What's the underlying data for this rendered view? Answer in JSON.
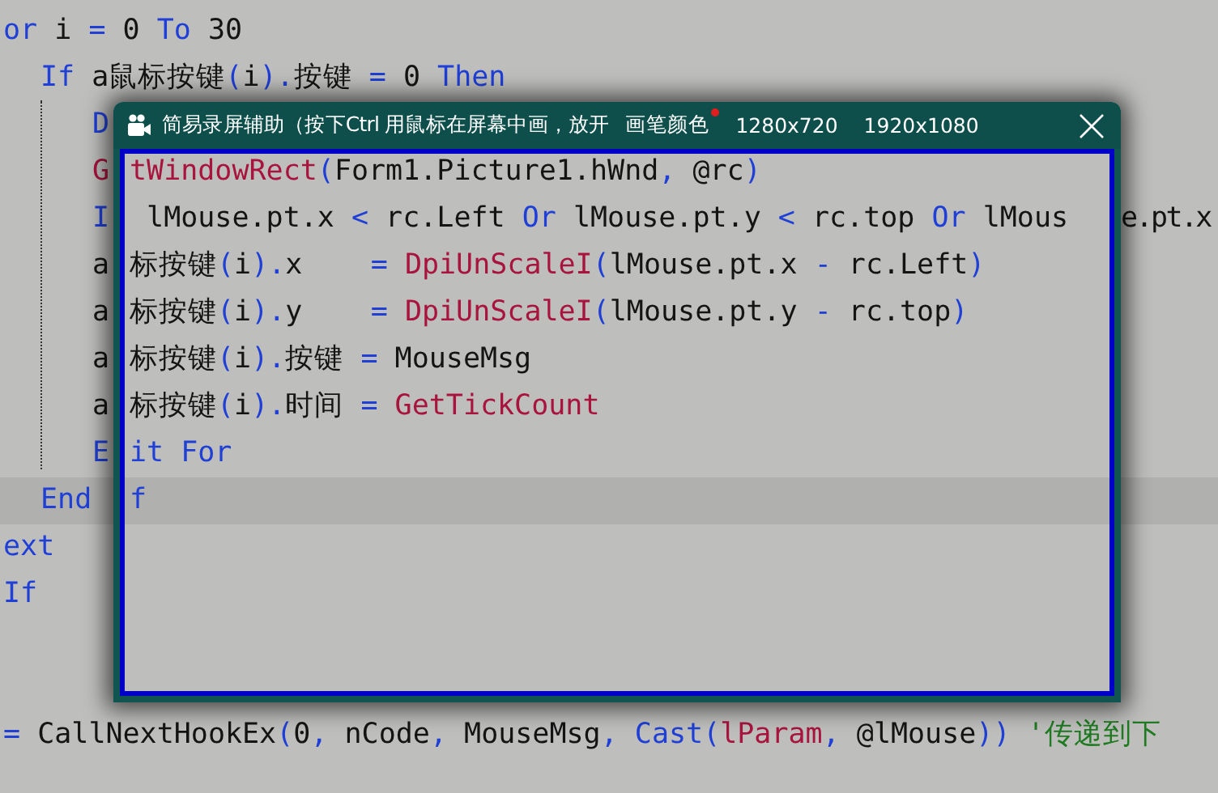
{
  "editor": {
    "lines": [
      {
        "current": false,
        "tokens": [
          {
            "kind": "kw",
            "text": "or"
          },
          {
            "kind": "id",
            "text": " i "
          },
          {
            "kind": "op",
            "text": "="
          },
          {
            "kind": "id",
            "text": " 0 "
          },
          {
            "kind": "kw",
            "text": "To"
          },
          {
            "kind": "id",
            "text": " 30"
          }
        ],
        "children": [
          {
            "current": false,
            "tokens": [
              {
                "kind": "kw",
                "text": "If"
              },
              {
                "kind": "id",
                "text": " a鼠标按键"
              },
              {
                "kind": "op",
                "text": "("
              },
              {
                "kind": "id",
                "text": "i"
              },
              {
                "kind": "op",
                "text": ")."
              },
              {
                "kind": "id",
                "text": "按键 "
              },
              {
                "kind": "op",
                "text": "="
              },
              {
                "kind": "id",
                "text": " 0 "
              },
              {
                "kind": "kw",
                "text": "Then"
              }
            ],
            "children": [
              {
                "current": false,
                "tokens": [
                  {
                    "kind": "kw",
                    "text": "D"
                  }
                ]
              },
              {
                "current": false,
                "tokens": [
                  {
                    "kind": "fn",
                    "text": "G"
                  }
                ],
                "inside": [
                  {
                    "kind": "fn",
                    "text": "tWindowRect"
                  },
                  {
                    "kind": "op",
                    "text": "("
                  },
                  {
                    "kind": "id",
                    "text": "Form1.Picture1.hWnd"
                  },
                  {
                    "kind": "op",
                    "text": ","
                  },
                  {
                    "kind": "id",
                    "text": " @rc"
                  },
                  {
                    "kind": "op",
                    "text": ")"
                  }
                ]
              },
              {
                "current": false,
                "tokens": [
                  {
                    "kind": "kw",
                    "text": "I"
                  }
                ],
                "inside": [
                  {
                    "kind": "id",
                    "text": " lMouse.pt.x "
                  },
                  {
                    "kind": "op",
                    "text": "<"
                  },
                  {
                    "kind": "id",
                    "text": " rc.Left "
                  },
                  {
                    "kind": "kw",
                    "text": "Or"
                  },
                  {
                    "kind": "id",
                    "text": " lMouse.pt.y "
                  },
                  {
                    "kind": "op",
                    "text": "<"
                  },
                  {
                    "kind": "id",
                    "text": " rc.top "
                  },
                  {
                    "kind": "kw",
                    "text": "Or"
                  },
                  {
                    "kind": "id",
                    "text": " lMous"
                  }
                ],
                "right": [
                  {
                    "kind": "id",
                    "text": "e.pt.x"
                  }
                ]
              },
              {
                "current": false,
                "tokens": [
                  {
                    "kind": "id",
                    "text": "a"
                  }
                ],
                "inside": [
                  {
                    "kind": "id",
                    "text": "标按键"
                  },
                  {
                    "kind": "op",
                    "text": "("
                  },
                  {
                    "kind": "id",
                    "text": "i"
                  },
                  {
                    "kind": "op",
                    "text": ")."
                  },
                  {
                    "kind": "id",
                    "text": "x    "
                  },
                  {
                    "kind": "op",
                    "text": "= "
                  },
                  {
                    "kind": "fn",
                    "text": "DpiUnScaleI"
                  },
                  {
                    "kind": "op",
                    "text": "("
                  },
                  {
                    "kind": "id",
                    "text": "lMouse.pt.x "
                  },
                  {
                    "kind": "op",
                    "text": "-"
                  },
                  {
                    "kind": "id",
                    "text": " rc.Left"
                  },
                  {
                    "kind": "op",
                    "text": ")"
                  }
                ]
              },
              {
                "current": false,
                "tokens": [
                  {
                    "kind": "id",
                    "text": "a"
                  }
                ],
                "inside": [
                  {
                    "kind": "id",
                    "text": "标按键"
                  },
                  {
                    "kind": "op",
                    "text": "("
                  },
                  {
                    "kind": "id",
                    "text": "i"
                  },
                  {
                    "kind": "op",
                    "text": ")."
                  },
                  {
                    "kind": "id",
                    "text": "y    "
                  },
                  {
                    "kind": "op",
                    "text": "= "
                  },
                  {
                    "kind": "fn",
                    "text": "DpiUnScaleI"
                  },
                  {
                    "kind": "op",
                    "text": "("
                  },
                  {
                    "kind": "id",
                    "text": "lMouse.pt.y "
                  },
                  {
                    "kind": "op",
                    "text": "-"
                  },
                  {
                    "kind": "id",
                    "text": " rc.top"
                  },
                  {
                    "kind": "op",
                    "text": ")"
                  }
                ]
              },
              {
                "current": false,
                "tokens": [
                  {
                    "kind": "id",
                    "text": "a"
                  }
                ],
                "inside": [
                  {
                    "kind": "id",
                    "text": "标按键"
                  },
                  {
                    "kind": "op",
                    "text": "("
                  },
                  {
                    "kind": "id",
                    "text": "i"
                  },
                  {
                    "kind": "op",
                    "text": ")."
                  },
                  {
                    "kind": "id",
                    "text": "按键 "
                  },
                  {
                    "kind": "op",
                    "text": "="
                  },
                  {
                    "kind": "id",
                    "text": " MouseMsg"
                  }
                ]
              },
              {
                "current": false,
                "tokens": [
                  {
                    "kind": "id",
                    "text": "a"
                  }
                ],
                "inside": [
                  {
                    "kind": "id",
                    "text": "标按键"
                  },
                  {
                    "kind": "op",
                    "text": "("
                  },
                  {
                    "kind": "id",
                    "text": "i"
                  },
                  {
                    "kind": "op",
                    "text": ")."
                  },
                  {
                    "kind": "id",
                    "text": "时间 "
                  },
                  {
                    "kind": "op",
                    "text": "= "
                  },
                  {
                    "kind": "fn",
                    "text": "GetTickCount"
                  }
                ]
              },
              {
                "current": false,
                "tokens": [
                  {
                    "kind": "kw",
                    "text": "E"
                  }
                ],
                "inside": [
                  {
                    "kind": "kw",
                    "text": "it For"
                  }
                ]
              }
            ]
          },
          {
            "current": true,
            "tokens": [
              {
                "kind": "kw",
                "text": "End"
              }
            ],
            "inside": [
              {
                "kind": "kw",
                "text": "f"
              }
            ]
          }
        ]
      },
      {
        "current": false,
        "tokens": [
          {
            "kind": "kw",
            "text": "ext"
          }
        ]
      },
      {
        "current": false,
        "tokens": [
          {
            "kind": "kw",
            "text": "If"
          }
        ]
      },
      {
        "current": false
      },
      {
        "current": false
      },
      {
        "current": false,
        "tokens": [
          {
            "kind": "op",
            "text": "="
          },
          {
            "kind": "id",
            "text": " CallNextHookEx"
          },
          {
            "kind": "op",
            "text": "("
          },
          {
            "kind": "id",
            "text": "0"
          },
          {
            "kind": "op",
            "text": ","
          },
          {
            "kind": "id",
            "text": " nCode"
          },
          {
            "kind": "op",
            "text": ","
          },
          {
            "kind": "id",
            "text": " MouseMsg"
          },
          {
            "kind": "op",
            "text": ", "
          },
          {
            "kind": "kw",
            "text": "Cast"
          },
          {
            "kind": "op",
            "text": "("
          },
          {
            "kind": "fn",
            "text": "lParam"
          },
          {
            "kind": "op",
            "text": ","
          },
          {
            "kind": "id",
            "text": " @lMouse"
          },
          {
            "kind": "op",
            "text": "))"
          },
          {
            "kind": "comment",
            "text": " '传递到下"
          }
        ]
      }
    ]
  },
  "window": {
    "title": "简易录屏辅助（按下Ctrl 用鼠标在屏幕中画，放开",
    "pen_color": {
      "label": "画笔颜色",
      "color": "#e01e1e"
    },
    "sizes": [
      "1280x720",
      "1920x1080"
    ]
  }
}
